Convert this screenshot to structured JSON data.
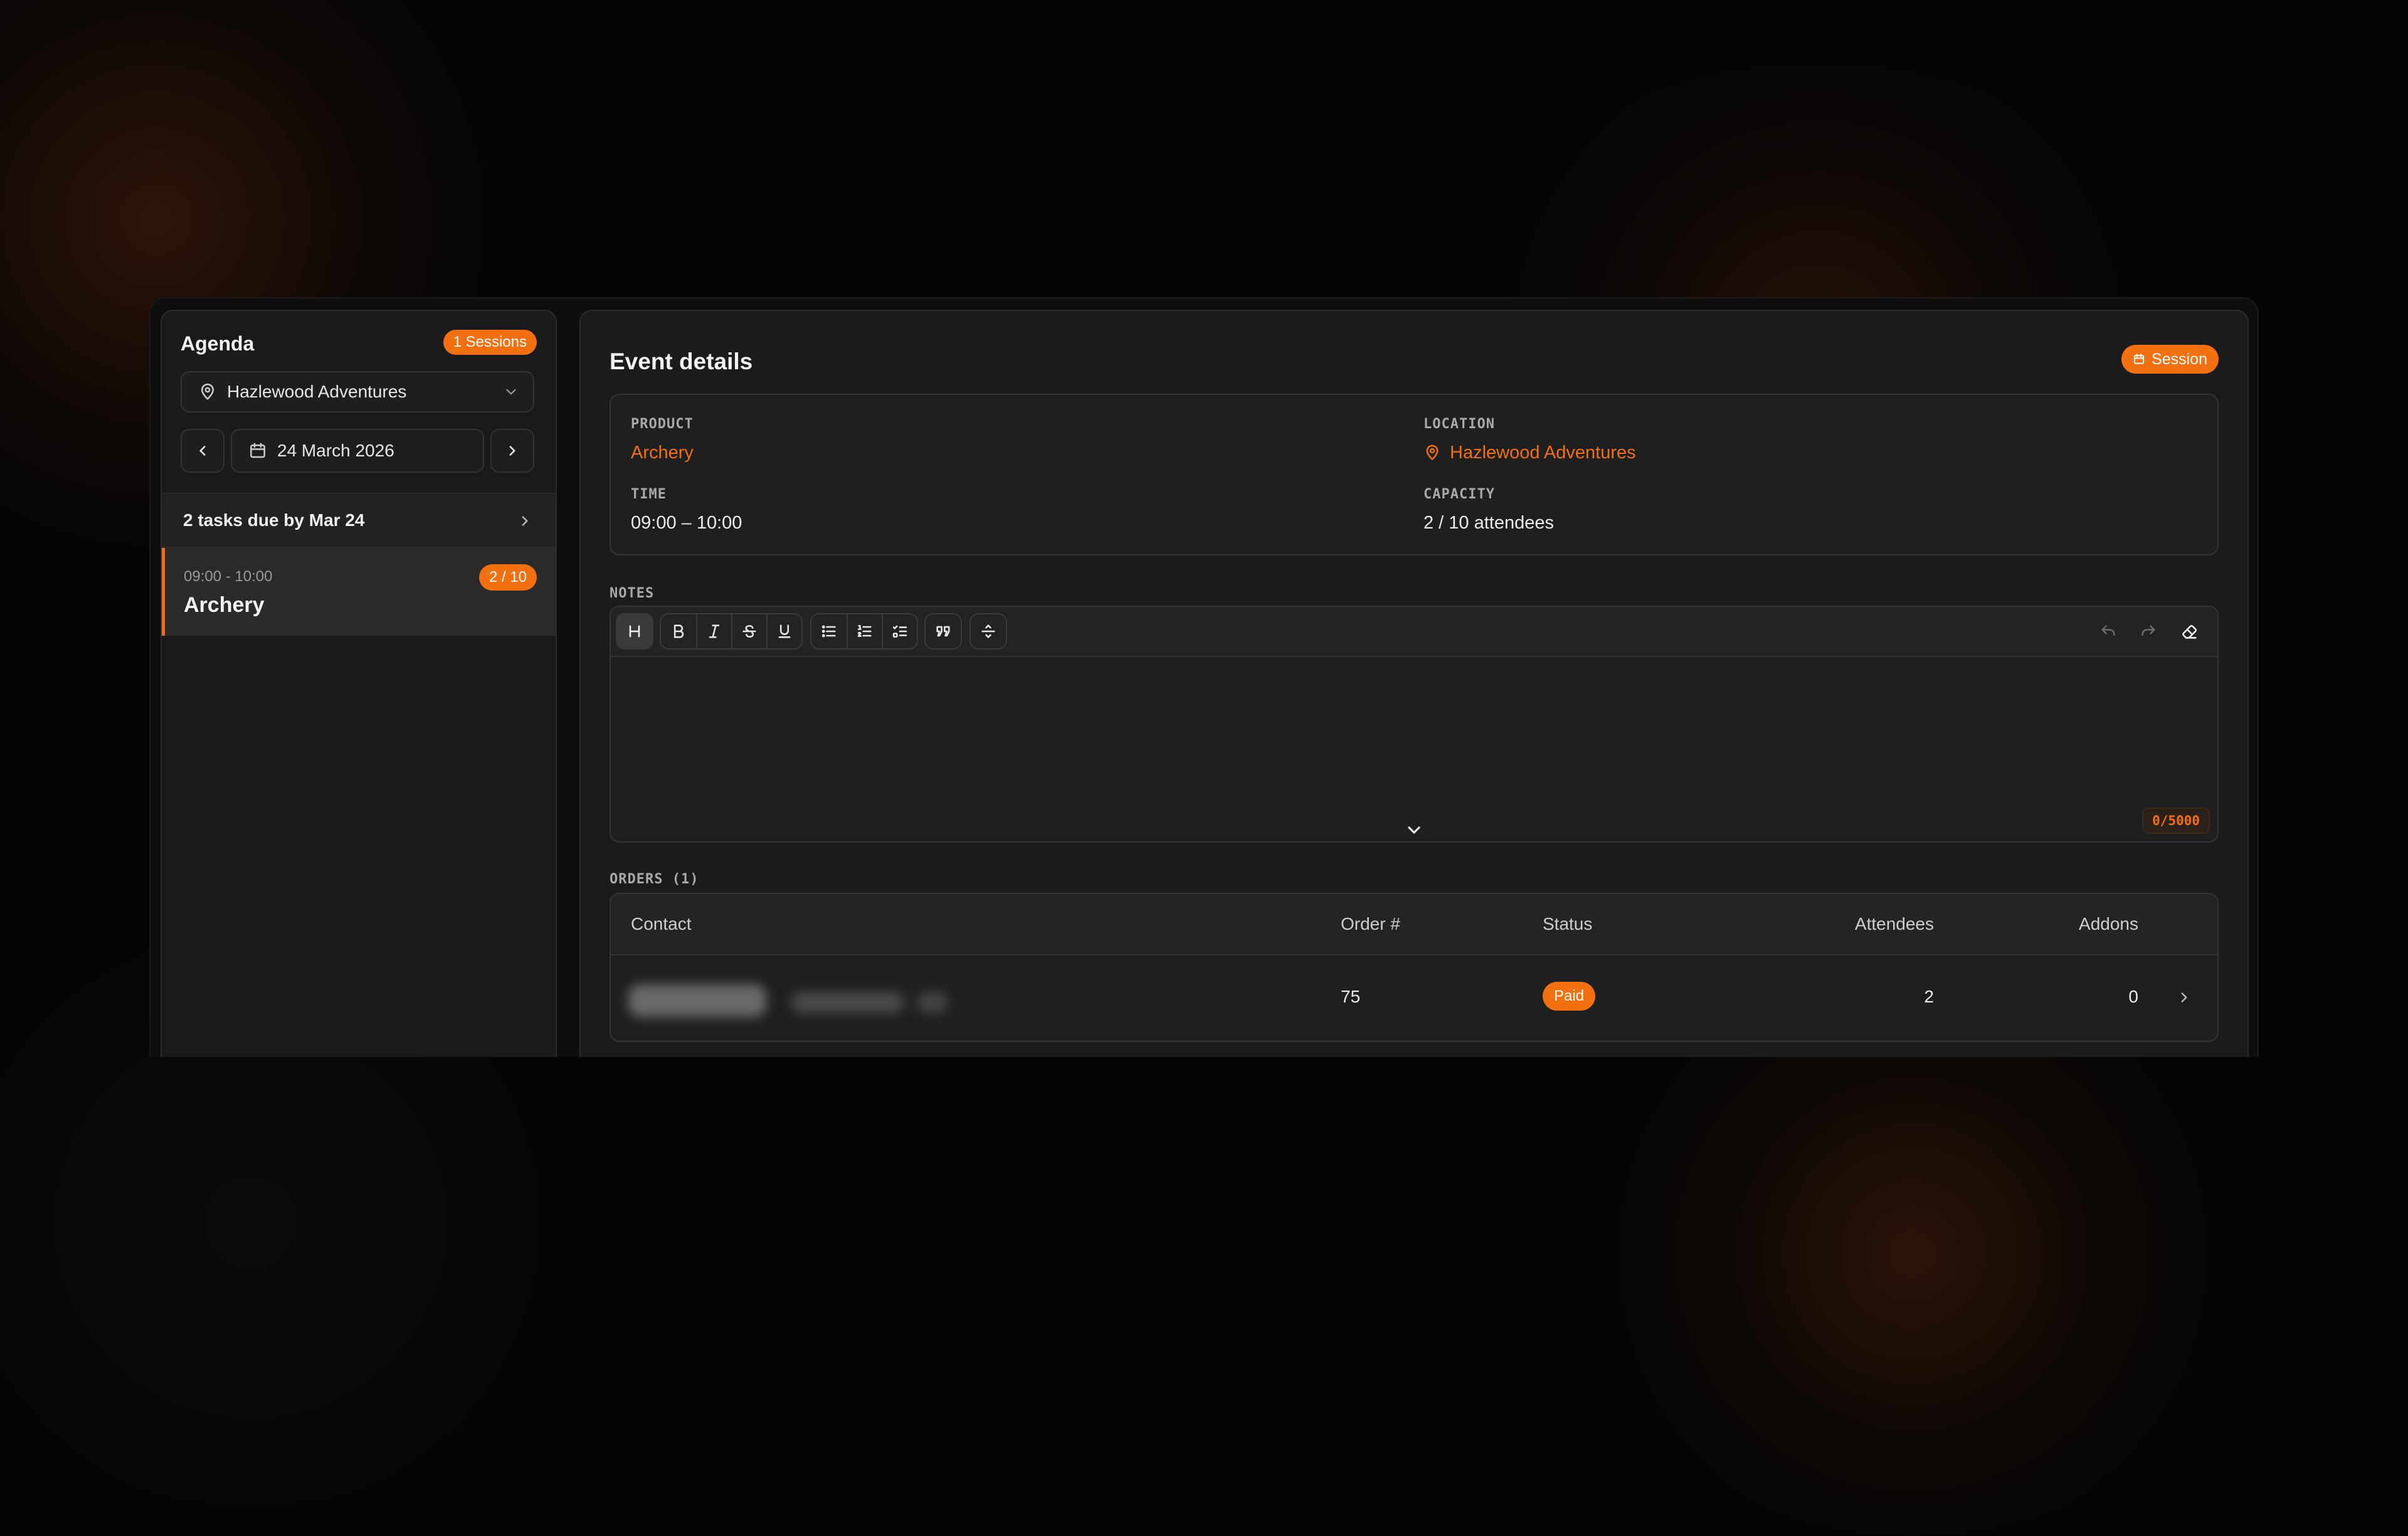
{
  "colors": {
    "accent": "#f2700f",
    "panel": "#1b1b1b",
    "background": "#050505"
  },
  "sidebar": {
    "title": "Agenda",
    "sessions_badge": "1 Sessions",
    "location_select": {
      "value": "Hazlewood Adventures",
      "icon": "map-pin-icon"
    },
    "date": {
      "value": "24 March 2026",
      "icon": "calendar-icon"
    },
    "tasks_due": "2 tasks due by Mar 24",
    "sessions": [
      {
        "time": "09:00 - 10:00",
        "name": "Archery",
        "capacity": "2 / 10"
      }
    ]
  },
  "main": {
    "title": "Event details",
    "badge": "Session",
    "details": {
      "product_label": "PRODUCT",
      "product": "Archery",
      "location_label": "LOCATION",
      "location": "Hazlewood Adventures",
      "time_label": "TIME",
      "time": "09:00 – 10:00",
      "capacity_label": "CAPACITY",
      "capacity": "2 / 10 attendees"
    },
    "notes": {
      "label": "NOTES",
      "counter": "0/5000",
      "toolbar": [
        "heading",
        "bold",
        "italic",
        "strikethrough",
        "underline",
        "bullet-list",
        "ordered-list",
        "task-list",
        "blockquote",
        "horizontal-rule",
        "undo",
        "redo",
        "clear-formatting"
      ]
    },
    "orders": {
      "label": "ORDERS (1)",
      "columns": [
        "Contact",
        "Order #",
        "Status",
        "Attendees",
        "Addons"
      ],
      "rows": [
        {
          "contact": "",
          "order": "75",
          "status": "Paid",
          "attendees": "2",
          "addons": "0"
        }
      ]
    }
  }
}
